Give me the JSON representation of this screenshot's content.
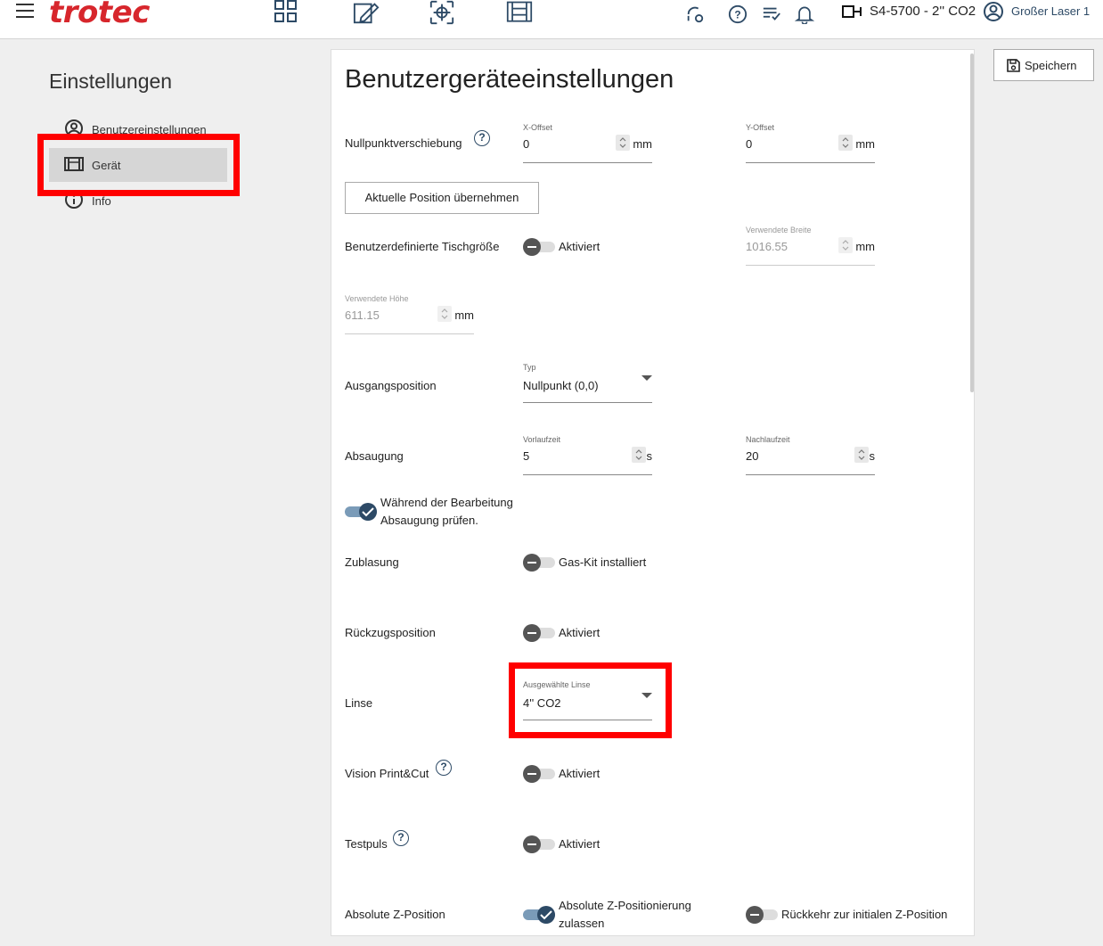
{
  "header": {
    "brand": "trotec",
    "device": "S4-5700 - 2'' CO2",
    "user": "Großer Laser 1"
  },
  "sidebar": {
    "title": "Einstellungen",
    "items": [
      {
        "label": "Benutzereinstellungen",
        "icon": "user-circle-icon"
      },
      {
        "label": "Gerät",
        "icon": "device-icon",
        "active": true
      },
      {
        "label": "Info",
        "icon": "info-icon"
      }
    ]
  },
  "save_button": "Speichern",
  "page": {
    "title": "Benutzergeräteeinstellungen",
    "nullpunkt": {
      "label": "Nullpunktverschiebung",
      "x_label": "X-Offset",
      "x_value": "0",
      "x_unit": "mm",
      "y_label": "Y-Offset",
      "y_value": "0",
      "y_unit": "mm",
      "button": "Aktuelle Position übernehmen"
    },
    "tischgroesse": {
      "label": "Benutzerdefinierte Tischgröße",
      "toggle": "Aktiviert",
      "breite_label": "Verwendete Breite",
      "breite_value": "1016.55",
      "breite_unit": "mm",
      "hoehe_label": "Verwendete Höhe",
      "hoehe_value": "611.15",
      "hoehe_unit": "mm"
    },
    "ausgangsposition": {
      "label": "Ausgangsposition",
      "typ_label": "Typ",
      "typ_value": "Nullpunkt (0,0)"
    },
    "absaugung": {
      "label": "Absaugung",
      "vor_label": "Vorlaufzeit",
      "vor_value": "5",
      "vor_unit": "s",
      "nach_label": "Nachlaufzeit",
      "nach_value": "20",
      "nach_unit": "s",
      "check_line1": "Während der Bearbeitung",
      "check_line2": "Absaugung prüfen."
    },
    "zublasung": {
      "label": "Zublasung",
      "toggle": "Gas-Kit installiert"
    },
    "rueckzug": {
      "label": "Rückzugsposition",
      "toggle": "Aktiviert"
    },
    "linse": {
      "label": "Linse",
      "select_label": "Ausgewählte Linse",
      "select_value": "4'' CO2"
    },
    "vision": {
      "label": "Vision Print&Cut",
      "toggle": "Aktiviert"
    },
    "testpuls": {
      "label": "Testpuls",
      "toggle": "Aktiviert"
    },
    "zpos": {
      "label": "Absolute Z-Position",
      "toggle1_line1": "Absolute Z-Positionierung",
      "toggle1_line2": "zulassen",
      "toggle2": "Rückkehr zur initialen Z-Position"
    },
    "help_glyph": "?"
  },
  "colors": {
    "brand": "#d7262c",
    "accent": "#2d4a66",
    "highlight": "#ff0000"
  }
}
